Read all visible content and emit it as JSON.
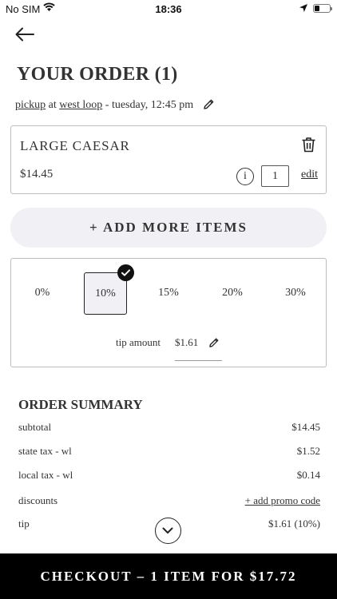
{
  "status_bar": {
    "carrier": "No SIM",
    "time": "18:36"
  },
  "page": {
    "title": "YOUR ORDER (1)"
  },
  "order_meta": {
    "method": "pickup",
    "at": "at",
    "location": "west loop",
    "time": "- tuesday, 12:45 pm"
  },
  "item": {
    "name": "LARGE CAESAR",
    "price": "$14.45",
    "info_glyph": "i",
    "quantity": "1",
    "edit_label": "edit"
  },
  "add_more_label": "+ ADD MORE ITEMS",
  "tip": {
    "options": [
      "0%",
      "10%",
      "15%",
      "20%",
      "30%"
    ],
    "selected": "10%",
    "amount_label": "tip amount",
    "amount_value": "$1.61"
  },
  "summary": {
    "title": "ORDER SUMMARY",
    "rows": [
      {
        "label": "subtotal",
        "value": "$14.45"
      },
      {
        "label": "state tax - wl",
        "value": "$1.52"
      },
      {
        "label": "local tax - wl",
        "value": "$0.14"
      },
      {
        "label": "discounts",
        "value": "+ add promo code"
      },
      {
        "label": "tip",
        "value": "$1.61 (10%)"
      }
    ]
  },
  "checkout_label": "CHECKOUT – 1 ITEM FOR $17.72",
  "icons": {
    "back": "arrow-left-icon",
    "pencil": "pencil-icon",
    "trash": "trash-icon",
    "info": "info-icon",
    "check": "check-icon",
    "chevron": "chevron-down-icon"
  },
  "colors": {
    "accent": "#000000",
    "pill_bg": "#f1f0f5",
    "border": "#bdbdbd",
    "text": "#2b2b2b"
  }
}
